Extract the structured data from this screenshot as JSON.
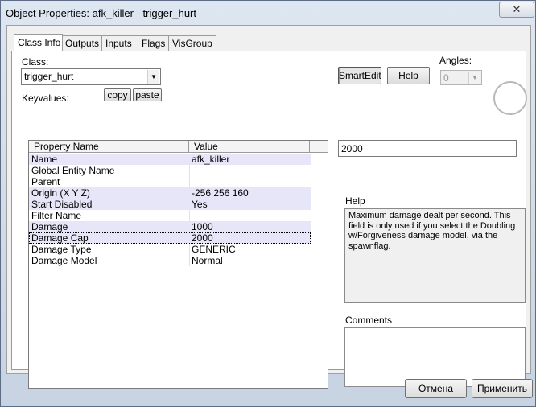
{
  "window": {
    "title": "Object Properties: afk_killer - trigger_hurt",
    "close_glyph": "✕"
  },
  "tabs": [
    {
      "label": "Class Info",
      "active": true
    },
    {
      "label": "Outputs"
    },
    {
      "label": "Inputs"
    },
    {
      "label": "Flags"
    },
    {
      "label": "VisGroup"
    }
  ],
  "class_section": {
    "class_label": "Class:",
    "class_value": "trigger_hurt",
    "keyvalues_label": "Keyvalues:",
    "copy_label": "copy",
    "paste_label": "paste"
  },
  "toolbar": {
    "smartedit_label": "SmartEdit",
    "help_label": "Help",
    "angles_label": "Angles:",
    "angles_value": "0"
  },
  "properties": {
    "columns": [
      "Property Name",
      "Value"
    ],
    "rows": [
      {
        "name": "Name",
        "value": "afk_killer"
      },
      {
        "name": "Global Entity Name",
        "value": ""
      },
      {
        "name": "Parent",
        "value": ""
      },
      {
        "name": "Origin (X Y Z)",
        "value": "-256 256 160"
      },
      {
        "name": "Start Disabled",
        "value": "Yes"
      },
      {
        "name": "Filter Name",
        "value": ""
      },
      {
        "name": "Damage",
        "value": "1000"
      },
      {
        "name": "Damage Cap",
        "value": "2000"
      },
      {
        "name": "Damage Type",
        "value": "GENERIC"
      },
      {
        "name": "Damage Model",
        "value": "Normal"
      }
    ]
  },
  "value_editor": {
    "value": "2000"
  },
  "help_panel": {
    "label": "Help",
    "text": "Maximum damage dealt per second. This field is only used if you select the Doubling w/Forgiveness damage model, via the spawnflag."
  },
  "comments": {
    "label": "Comments",
    "text": ""
  },
  "footer": {
    "cancel_label": "Отмена",
    "apply_label": "Применить"
  }
}
